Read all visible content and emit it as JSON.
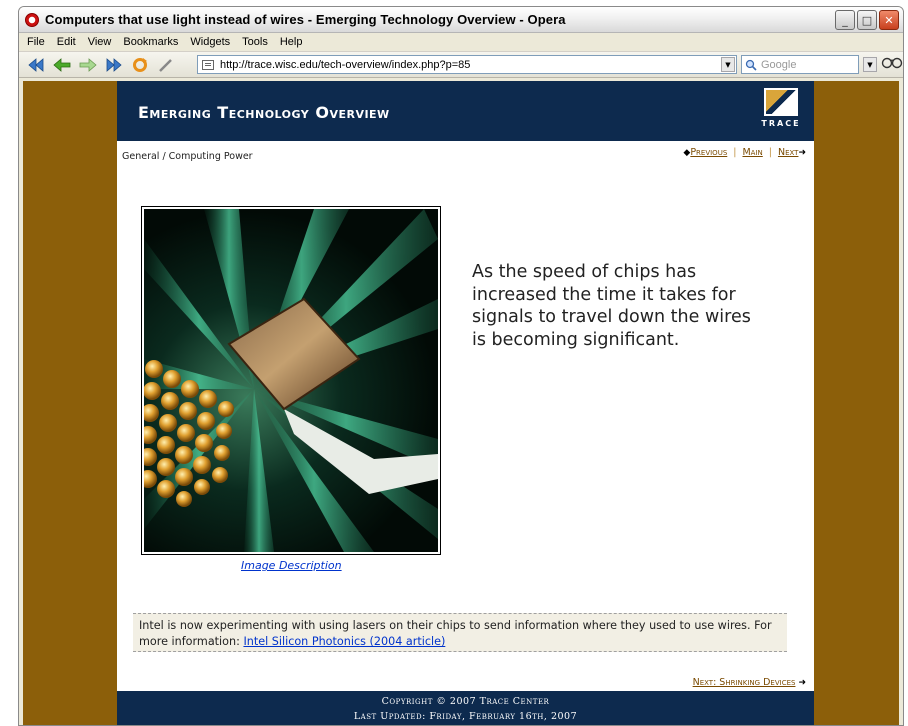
{
  "window": {
    "title": "Computers that use light instead of wires - Emerging Technology Overview - Opera",
    "minimize_label": "_",
    "maximize_label": "□",
    "close_label": "✕"
  },
  "menu": [
    "File",
    "Edit",
    "View",
    "Bookmarks",
    "Widgets",
    "Tools",
    "Help"
  ],
  "toolbar": {
    "url": "http://trace.wisc.edu/tech-overview/index.php?p=85",
    "search_placeholder": "Google",
    "icons": [
      "rewind-icon",
      "back-icon",
      "forward-icon",
      "fast-forward-icon",
      "reload-icon",
      "edit-icon",
      "page-icon",
      "search-icon",
      "glasses-icon"
    ]
  },
  "page": {
    "site_title": "Emerging Technology Overview",
    "logo_text": "TRACE",
    "breadcrumb": "General / Computing Power",
    "nav": {
      "previous": "Previous",
      "main": "Main",
      "next": "Next"
    },
    "main_text": "As the speed of chips has increased the time it takes for signals to travel down the wires is becoming significant.",
    "image_description_link": "Image Description",
    "info_text": "Intel is now experimenting with using lasers on their chips to send information where they used to use wires. For more information: ",
    "info_link": "Intel Silicon Photonics (2004 article)",
    "next_page_link": "Next: Shrinking Devices",
    "footer_line1": "Copyright © 2007 Trace Center",
    "footer_line2": "Last Updated: Friday, February 16th, 2007"
  },
  "colors": {
    "background": "#8c5f0a",
    "header": "#0d2a4e",
    "link": "#0033cc",
    "nav_link": "#7a4a00"
  }
}
